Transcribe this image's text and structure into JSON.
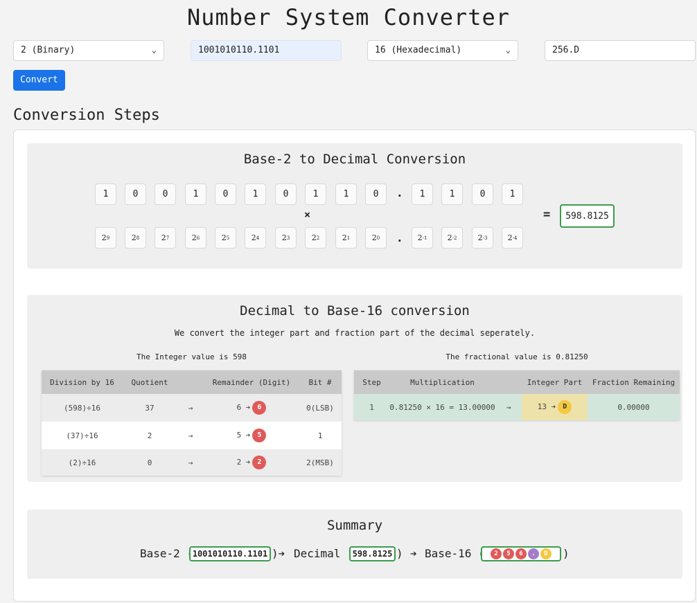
{
  "header": {
    "title": "Number System Converter"
  },
  "controls": {
    "from_base": "2 (Binary)",
    "input_value": "1001010110.1101",
    "to_base": "16 (Hexadecimal)",
    "output_value": "256.D",
    "convert_label": "Convert"
  },
  "steps_title": "Conversion Steps",
  "to_decimal": {
    "title": "Base-2 to Decimal Conversion",
    "digits": [
      "1",
      "0",
      "0",
      "1",
      "0",
      "1",
      "0",
      "1",
      "1",
      "0",
      ".",
      "1",
      "1",
      "0",
      "1"
    ],
    "powers": [
      {
        "base": "2",
        "exp": "9"
      },
      {
        "base": "2",
        "exp": "8"
      },
      {
        "base": "2",
        "exp": "7"
      },
      {
        "base": "2",
        "exp": "6"
      },
      {
        "base": "2",
        "exp": "5"
      },
      {
        "base": "2",
        "exp": "4"
      },
      {
        "base": "2",
        "exp": "3"
      },
      {
        "base": "2",
        "exp": "2"
      },
      {
        "base": "2",
        "exp": "1"
      },
      {
        "base": "2",
        "exp": "0"
      },
      {
        "base": "2",
        "exp": "-1"
      },
      {
        "base": "2",
        "exp": "-2"
      },
      {
        "base": "2",
        "exp": "-3"
      },
      {
        "base": "2",
        "exp": "-4"
      }
    ],
    "times_symbol": "×",
    "dot_symbol": ".",
    "equals_symbol": "=",
    "result": "598.8125"
  },
  "from_decimal": {
    "title": "Decimal to Base-16 conversion",
    "description": "We convert the integer part and fraction part of the decimal seperately.",
    "integer_caption": "The Integer value is 598",
    "fraction_caption": "The fractional value is 0.81250",
    "integer_table": {
      "headers": [
        "Division by 16",
        "Quotient",
        "",
        "Remainder (Digit)",
        "Bit #"
      ],
      "rows": [
        {
          "division": "(598)÷16",
          "quotient": "37",
          "arrow": "→",
          "remainder": "6 ➔",
          "digit": "6",
          "bit": "0(LSB)"
        },
        {
          "division": "(37)÷16",
          "quotient": "2",
          "arrow": "→",
          "remainder": "5 ➔",
          "digit": "5",
          "bit": "1"
        },
        {
          "division": "(2)÷16",
          "quotient": "0",
          "arrow": "→",
          "remainder": "2 ➔",
          "digit": "2",
          "bit": "2(MSB)"
        }
      ]
    },
    "fraction_table": {
      "headers": [
        "Step",
        "Multiplication",
        "",
        "Integer Part",
        "Fraction Remaining"
      ],
      "rows": [
        {
          "step": "1",
          "multiplication": "0.81250 × 16 = 13.00000",
          "arrow": "→",
          "integer_part": "13 ➔",
          "digit": "D",
          "remaining": "0.00000"
        }
      ]
    }
  },
  "summary": {
    "title": "Summary",
    "from_label": "Base-2 (",
    "from_value": "1001010110.1101",
    "close_paren_arrow": ")➔",
    "decimal_label": "Decimal (",
    "decimal_value": "598.8125",
    "close_paren": ")",
    "arrow": "➔",
    "to_label": "Base-16 (",
    "result_digits": [
      "2",
      "5",
      "6",
      ".",
      "D"
    ],
    "end_paren": ")"
  },
  "colors": {
    "accent": "#1a73e8",
    "success_border": "#3a9d4a",
    "badge_red": "#e05a5a",
    "badge_yellow": "#f5c842",
    "badge_purple": "#a57cc9"
  }
}
